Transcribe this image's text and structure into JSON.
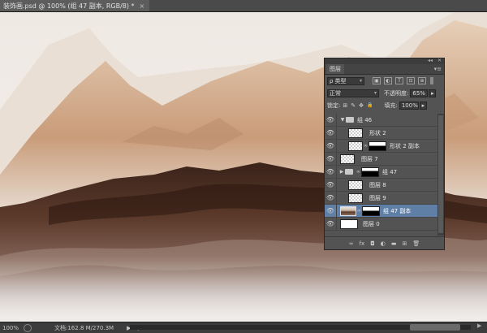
{
  "document_tab": {
    "title": "装饰画.psd @ 100% (组 47 副本, RGB/8) *",
    "close_icon": "×"
  },
  "status": {
    "zoom": "100%",
    "doc_size": "文档:162.8 M/270.3M",
    "arrow_icon": "▶",
    "scroll_left": "◀",
    "scroll_right": "▶"
  },
  "layers_panel": {
    "collapse_icon": "◂◂",
    "close_icon": "✕",
    "tab_label": "图层",
    "menu_icon": "▾≡",
    "filter": {
      "kind_icon": "ρ",
      "kind_label": "类型",
      "dropdown_icon": "▾",
      "filter_buttons": [
        "▣",
        "◐",
        "T",
        "⊡",
        "⊕"
      ]
    },
    "blend": {
      "mode": "正常",
      "dropdown_icon": "▾",
      "opacity_label": "不透明度:",
      "opacity_value": "65%",
      "opacity_arrow": "▸"
    },
    "lock": {
      "label": "锁定:",
      "icons": [
        "⊞",
        "✎",
        "✥",
        "🔒"
      ],
      "fill_label": "填充:",
      "fill_value": "100%",
      "fill_arrow": "▸"
    },
    "layers": [
      {
        "name": "组 46",
        "expand_icon": "▼",
        "eye_icon": "👁"
      },
      {
        "name": "形状 2",
        "eye_icon": "👁"
      },
      {
        "name": "形状 2 副本",
        "link_icon": "∞",
        "eye_icon": "👁"
      },
      {
        "name": "图层 7",
        "eye_icon": "👁"
      },
      {
        "name": "组 47",
        "expand_icon": "▶",
        "link_icon": "∞",
        "eye_icon": "👁"
      },
      {
        "name": "图层 8",
        "eye_icon": "👁"
      },
      {
        "name": "图层 9",
        "eye_icon": "👁"
      },
      {
        "name": "组 47 副本",
        "link_icon": "∞",
        "eye_icon": "👁"
      },
      {
        "name": "图层 0",
        "eye_icon": "👁"
      }
    ],
    "footer_icons": [
      "∞",
      "fx",
      "◘",
      "◐",
      "▬",
      "⊞",
      "🗑"
    ]
  }
}
